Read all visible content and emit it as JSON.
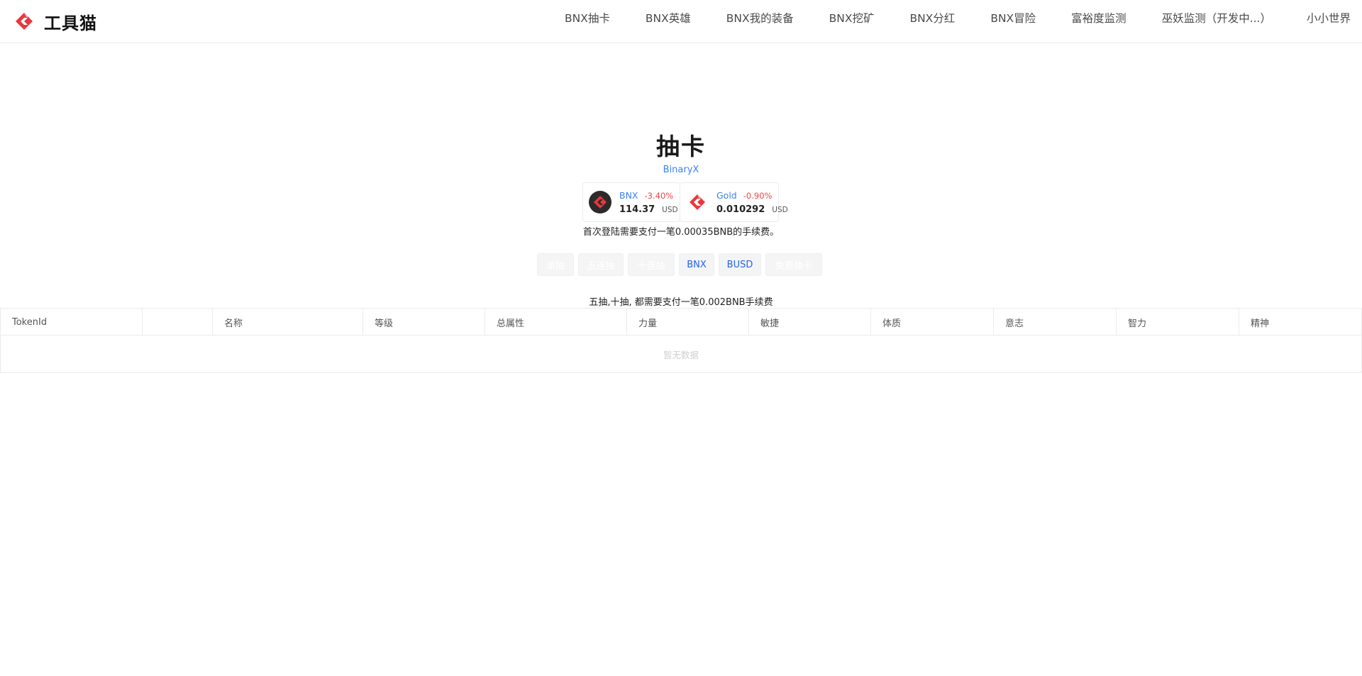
{
  "header": {
    "logo_text": "工具猫",
    "nav": [
      {
        "label": "BNX抽卡"
      },
      {
        "label": "BNX英雄"
      },
      {
        "label": "BNX我的装备"
      },
      {
        "label": "BNX挖矿"
      },
      {
        "label": "BNX分红"
      },
      {
        "label": "BNX冒险"
      },
      {
        "label": "富裕度监测"
      },
      {
        "label": "巫妖监测（开发中...）"
      },
      {
        "label": "小小世界"
      }
    ]
  },
  "hero": {
    "title": "抽卡",
    "subtitle": "BinaryX"
  },
  "prices": [
    {
      "name": "BNX",
      "change": "-3.40%",
      "price": "114.37",
      "unit": "USD",
      "icon": "bnx-coin-icon"
    },
    {
      "name": "Gold",
      "change": "-0.90%",
      "price": "0.010292",
      "unit": "USD",
      "icon": "gold-coin-icon"
    }
  ],
  "notes": {
    "login_fee": "首次登陆需要支付一笔0.00035BNB的手续费。",
    "draw_fee": "五抽,十抽, 都需要支付一笔0.002BNB手续费"
  },
  "buttons": [
    {
      "label": "单抽",
      "state": "disabled"
    },
    {
      "label": "五连抽",
      "state": "disabled"
    },
    {
      "label": "十连抽",
      "state": "disabled"
    },
    {
      "label": "BNX",
      "state": "active"
    },
    {
      "label": "BUSD",
      "state": "active"
    },
    {
      "label": "免费抽卡",
      "state": "disabled"
    }
  ],
  "table": {
    "columns": [
      "TokenId",
      "",
      "名称",
      "等级",
      "总属性",
      "力量",
      "敏捷",
      "体质",
      "意志",
      "智力",
      "精神"
    ],
    "empty_text": "暂无数据"
  },
  "colors": {
    "link": "#3b82f6",
    "negative": "#ef4444",
    "brand": "#e8383d"
  }
}
